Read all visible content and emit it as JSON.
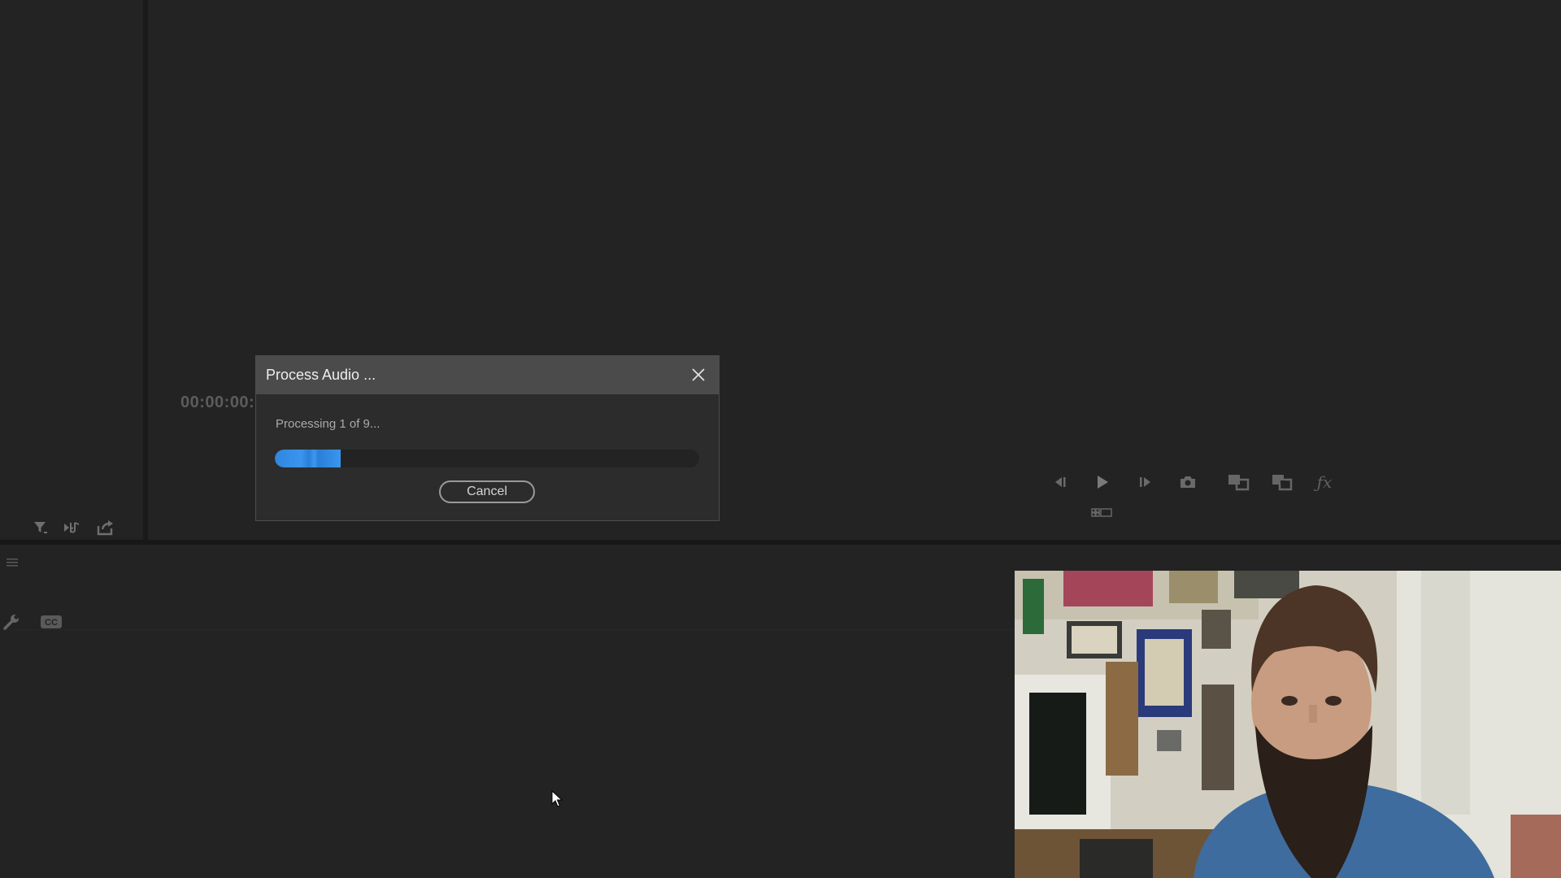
{
  "source_monitor": {
    "timecode": "00:00:00:",
    "bottom_icons": [
      "filter-icon",
      "insert-clip-icon",
      "export-icon"
    ]
  },
  "program_monitor": {
    "transport_icons": [
      "step-back-icon",
      "play-icon",
      "step-forward-icon",
      "camera-icon",
      "overlay-icon",
      "compare-icon",
      "fx-icon",
      "multicam-icon"
    ]
  },
  "timeline": {
    "tool_icons": [
      "hamburger-icon",
      "wrench-icon",
      "captions-icon"
    ]
  },
  "dialog": {
    "title": "Process Audio ...",
    "status": "Processing 1 of 9...",
    "progress_percent": 15.5,
    "cancel_label": "Cancel",
    "close_icon": "close-icon"
  },
  "colors": {
    "accent_progress": "#3a95ee",
    "background": "#222222"
  }
}
